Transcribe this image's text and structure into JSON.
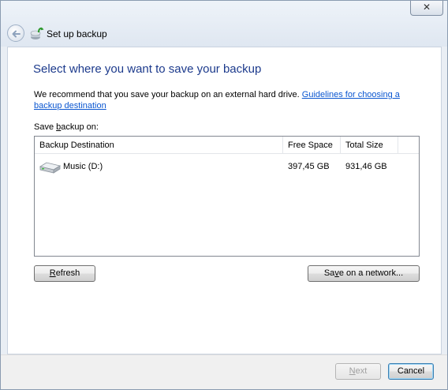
{
  "titlebar": {
    "title": "Set up backup",
    "close_glyph": "✕",
    "back_icon": "back-arrow-icon",
    "app_icon": "backup-icon"
  },
  "main": {
    "heading": "Select where you want to save your backup",
    "recommend_text": "We recommend that you save your backup on an external hard drive. ",
    "guidelines_link": "Guidelines for choosing a backup destination",
    "save_label_pre": "Save ",
    "save_label_accel": "b",
    "save_label_post": "ackup on:"
  },
  "list": {
    "columns": [
      "Backup Destination",
      "Free Space",
      "Total Size"
    ],
    "rows": [
      {
        "icon": "hard-drive-icon",
        "destination": "Music (D:)",
        "free_space": "397,45 GB",
        "total_size": "931,46 GB"
      }
    ]
  },
  "buttons": {
    "refresh_accel": "R",
    "refresh_rest": "efresh",
    "network_pre": "Sa",
    "network_accel": "v",
    "network_post": "e on a network...",
    "next_accel": "N",
    "next_rest": "ext",
    "cancel": "Cancel"
  },
  "colors": {
    "heading": "#1c3a8c",
    "link": "#0a56d0"
  }
}
